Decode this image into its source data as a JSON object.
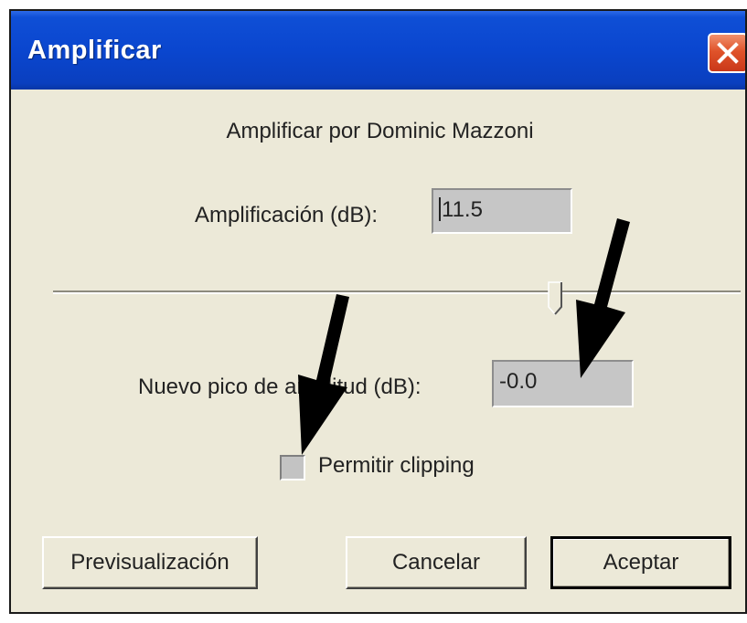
{
  "window": {
    "title": "Amplificar"
  },
  "caption": "Amplificar por Dominic Mazzoni",
  "amplification": {
    "label": "Amplificación (dB):",
    "value": "11.5"
  },
  "slider": {
    "level": 0.73
  },
  "new_peak": {
    "label": "Nuevo pico de amplitud (dB):",
    "value": "-0.0"
  },
  "clipping": {
    "label": "Permitir clipping",
    "checked": false
  },
  "buttons": {
    "preview": "Previsualización",
    "cancel": "Cancelar",
    "ok": "Aceptar"
  },
  "colors": {
    "titlebar": "#0a46cf",
    "dialog_bg": "#ece9d8",
    "field_bg": "#c6c6c6",
    "close": "#e0532a",
    "annotation_arrows": "#000000"
  }
}
